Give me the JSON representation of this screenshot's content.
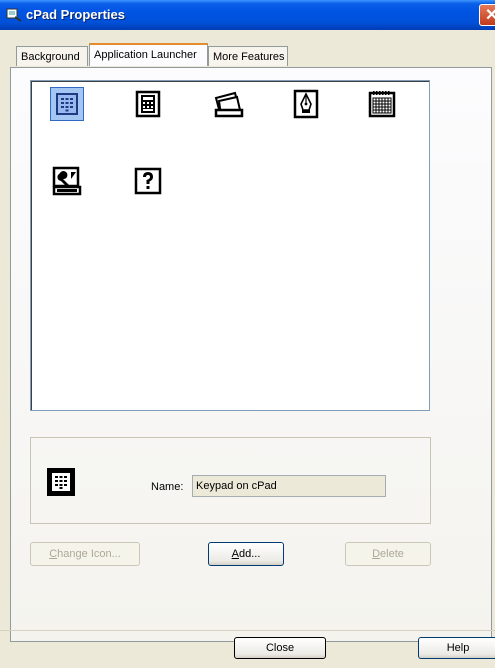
{
  "window": {
    "title": "cPad Properties",
    "close_glyph": "✕"
  },
  "tabs": [
    {
      "label": "Background",
      "active": false
    },
    {
      "label": "Application Launcher",
      "active": true
    },
    {
      "label": "More Features",
      "active": false
    }
  ],
  "icon_list": [
    {
      "icon": "keypad-icon",
      "selected": true
    },
    {
      "icon": "calculator-icon",
      "selected": false
    },
    {
      "icon": "folder-pages-icon",
      "selected": false
    },
    {
      "icon": "pen-nib-icon",
      "selected": false
    },
    {
      "icon": "calendar-icon",
      "selected": false
    },
    {
      "icon": "settings-tools-icon",
      "selected": false
    },
    {
      "icon": "help-question-icon",
      "selected": false
    }
  ],
  "details": {
    "name_label": "Name:",
    "name_value": "Keypad on cPad",
    "selected_icon": "keypad-icon"
  },
  "buttons": {
    "change_icon": {
      "accel": "C",
      "rest": "hange Icon...",
      "enabled": false
    },
    "add": {
      "accel": "A",
      "rest": "dd...",
      "enabled": true
    },
    "delete": {
      "accel": "D",
      "rest": "elete",
      "enabled": false
    },
    "close": "Close",
    "help": "Help"
  },
  "colors": {
    "titlebar": "#0054e3",
    "selection": "#a4c6f2",
    "tab_highlight": "#e68b2c"
  }
}
